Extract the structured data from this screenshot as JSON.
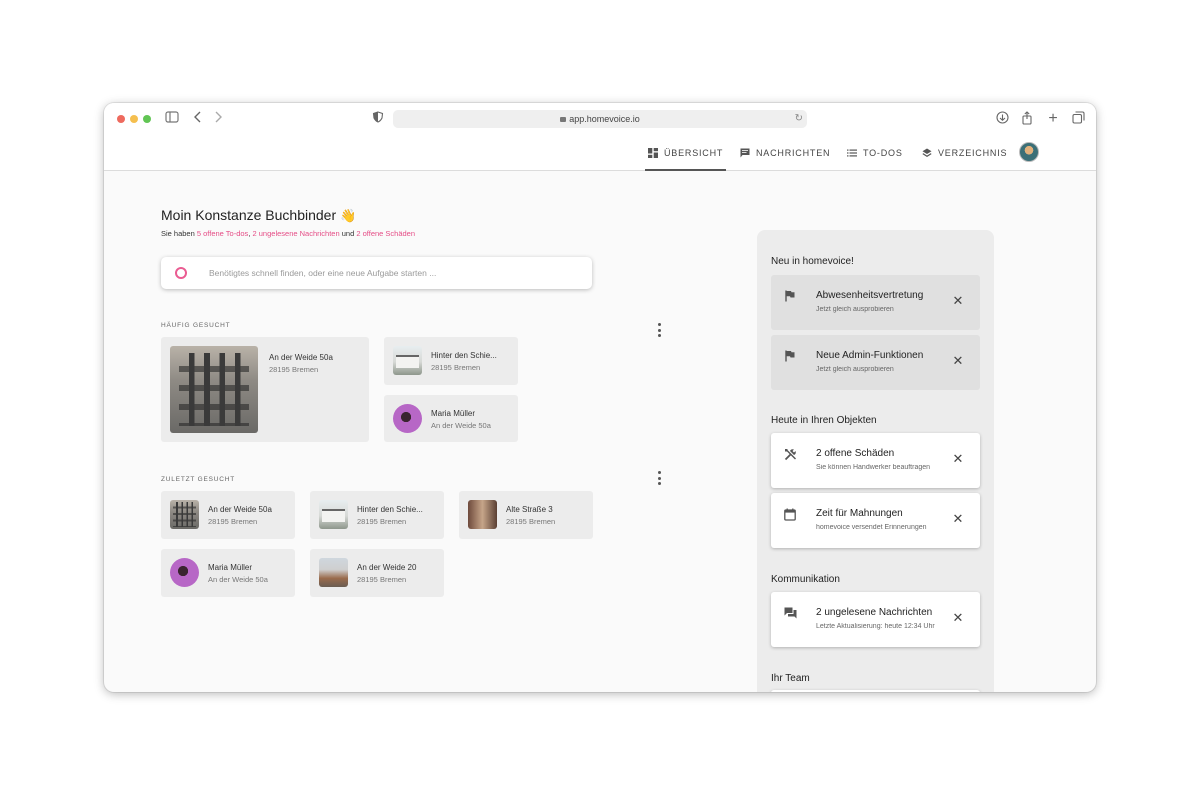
{
  "browser": {
    "url": "app.homevoice.io"
  },
  "nav": {
    "items": [
      {
        "label": "ÜBERSICHT"
      },
      {
        "label": "NACHRICHTEN"
      },
      {
        "label": "TO-DOS"
      },
      {
        "label": "VERZEICHNIS"
      }
    ]
  },
  "main": {
    "greeting": "Moin Konstanze Buchbinder",
    "summary_prefix": "Sie haben",
    "summary_todos": "5 offene To-dos",
    "summary_comma": ",",
    "summary_messages": "2 ungelesene Nachrichten",
    "summary_and": "und",
    "summary_damages": "2 offene Schäden",
    "search_placeholder": "Benötigtes schnell finden, oder eine neue Aufgabe starten ...",
    "frequent_label": "HÄUFIG GESUCHT",
    "frequent": [
      {
        "title": "An der Weide 50a",
        "subtitle": "28195 Bremen"
      },
      {
        "title": "Hinter den Schie...",
        "subtitle": "28195 Bremen"
      },
      {
        "title": "Maria Müller",
        "subtitle": "An der Weide 50a"
      }
    ],
    "recent_label": "ZULETZT GESUCHT",
    "recent": [
      {
        "title": "An der Weide 50a",
        "subtitle": "28195 Bremen"
      },
      {
        "title": "Hinter den Schie...",
        "subtitle": "28195 Bremen"
      },
      {
        "title": "Alte Straße 3",
        "subtitle": "28195 Bremen"
      },
      {
        "title": "Maria Müller",
        "subtitle": "An der Weide 50a"
      },
      {
        "title": "An der Weide 20",
        "subtitle": "28195 Bremen"
      }
    ]
  },
  "panel": {
    "new_title": "Neu in homevoice!",
    "new": [
      {
        "title": "Abwesenheitsvertretung",
        "subtitle": "Jetzt gleich ausprobieren"
      },
      {
        "title": "Neue Admin-Funktionen",
        "subtitle": "Jetzt gleich ausprobieren"
      }
    ],
    "today_title": "Heute in Ihren Objekten",
    "today": [
      {
        "title": "2 offene Schäden",
        "subtitle": "Sie können Handwerker beauftragen"
      },
      {
        "title": "Zeit für Mahnungen",
        "subtitle": "homevoice versendet Erinnerungen"
      }
    ],
    "comm_title": "Kommunikation",
    "comm": [
      {
        "title": "2 ungelesene Nachrichten",
        "subtitle": "Letzte Aktualisierung: heute 12:34 Uhr"
      }
    ],
    "team_title": "Ihr Team"
  },
  "colors": {
    "accent": "#e54d86"
  }
}
